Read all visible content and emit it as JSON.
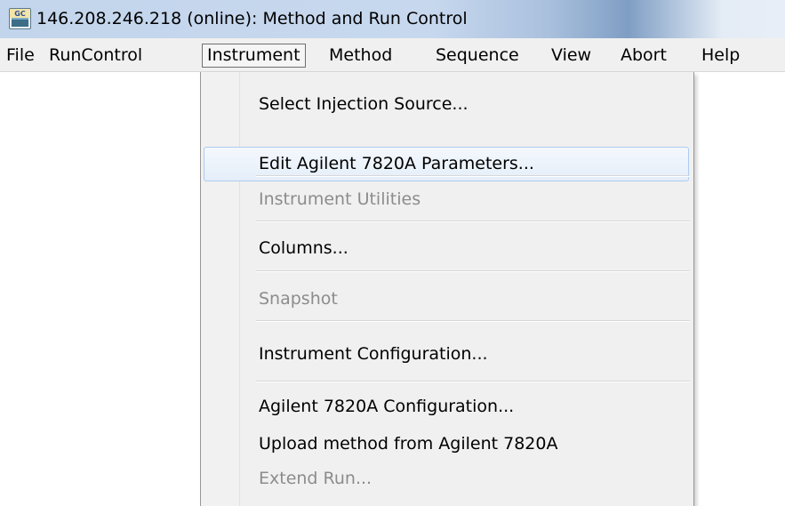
{
  "window": {
    "title": "146.208.246.218 (online): Method and Run Control",
    "icon": "gc-app-icon",
    "icon_text": "GC"
  },
  "menubar": {
    "items": [
      {
        "label": "File"
      },
      {
        "label": "RunControl"
      },
      {
        "label": "Instrument"
      },
      {
        "label": "Method"
      },
      {
        "label": "Sequence"
      },
      {
        "label": "View"
      },
      {
        "label": "Abort"
      },
      {
        "label": "Help"
      }
    ],
    "active": "Instrument"
  },
  "dropdown": {
    "items": [
      {
        "label": "Select Injection Source...",
        "enabled": true
      },
      {
        "label": "Edit Agilent 7820A Parameters...",
        "enabled": true,
        "highlighted": true
      },
      {
        "label": "Instrument Utilities",
        "enabled": false
      },
      {
        "label": "Columns...",
        "enabled": true
      },
      {
        "label": "Snapshot",
        "enabled": false
      },
      {
        "label": "Instrument Configuration...",
        "enabled": true
      },
      {
        "label": "Agilent 7820A Configuration...",
        "enabled": true
      },
      {
        "label": "Upload method from Agilent 7820A",
        "enabled": true
      },
      {
        "label": "Extend Run...",
        "enabled": false
      }
    ]
  },
  "colors": {
    "highlight_bg": "#e4eef9",
    "highlight_border": "#aecbee",
    "disabled_text": "#8c8c8c",
    "menu_bg": "#f0f0f0"
  }
}
